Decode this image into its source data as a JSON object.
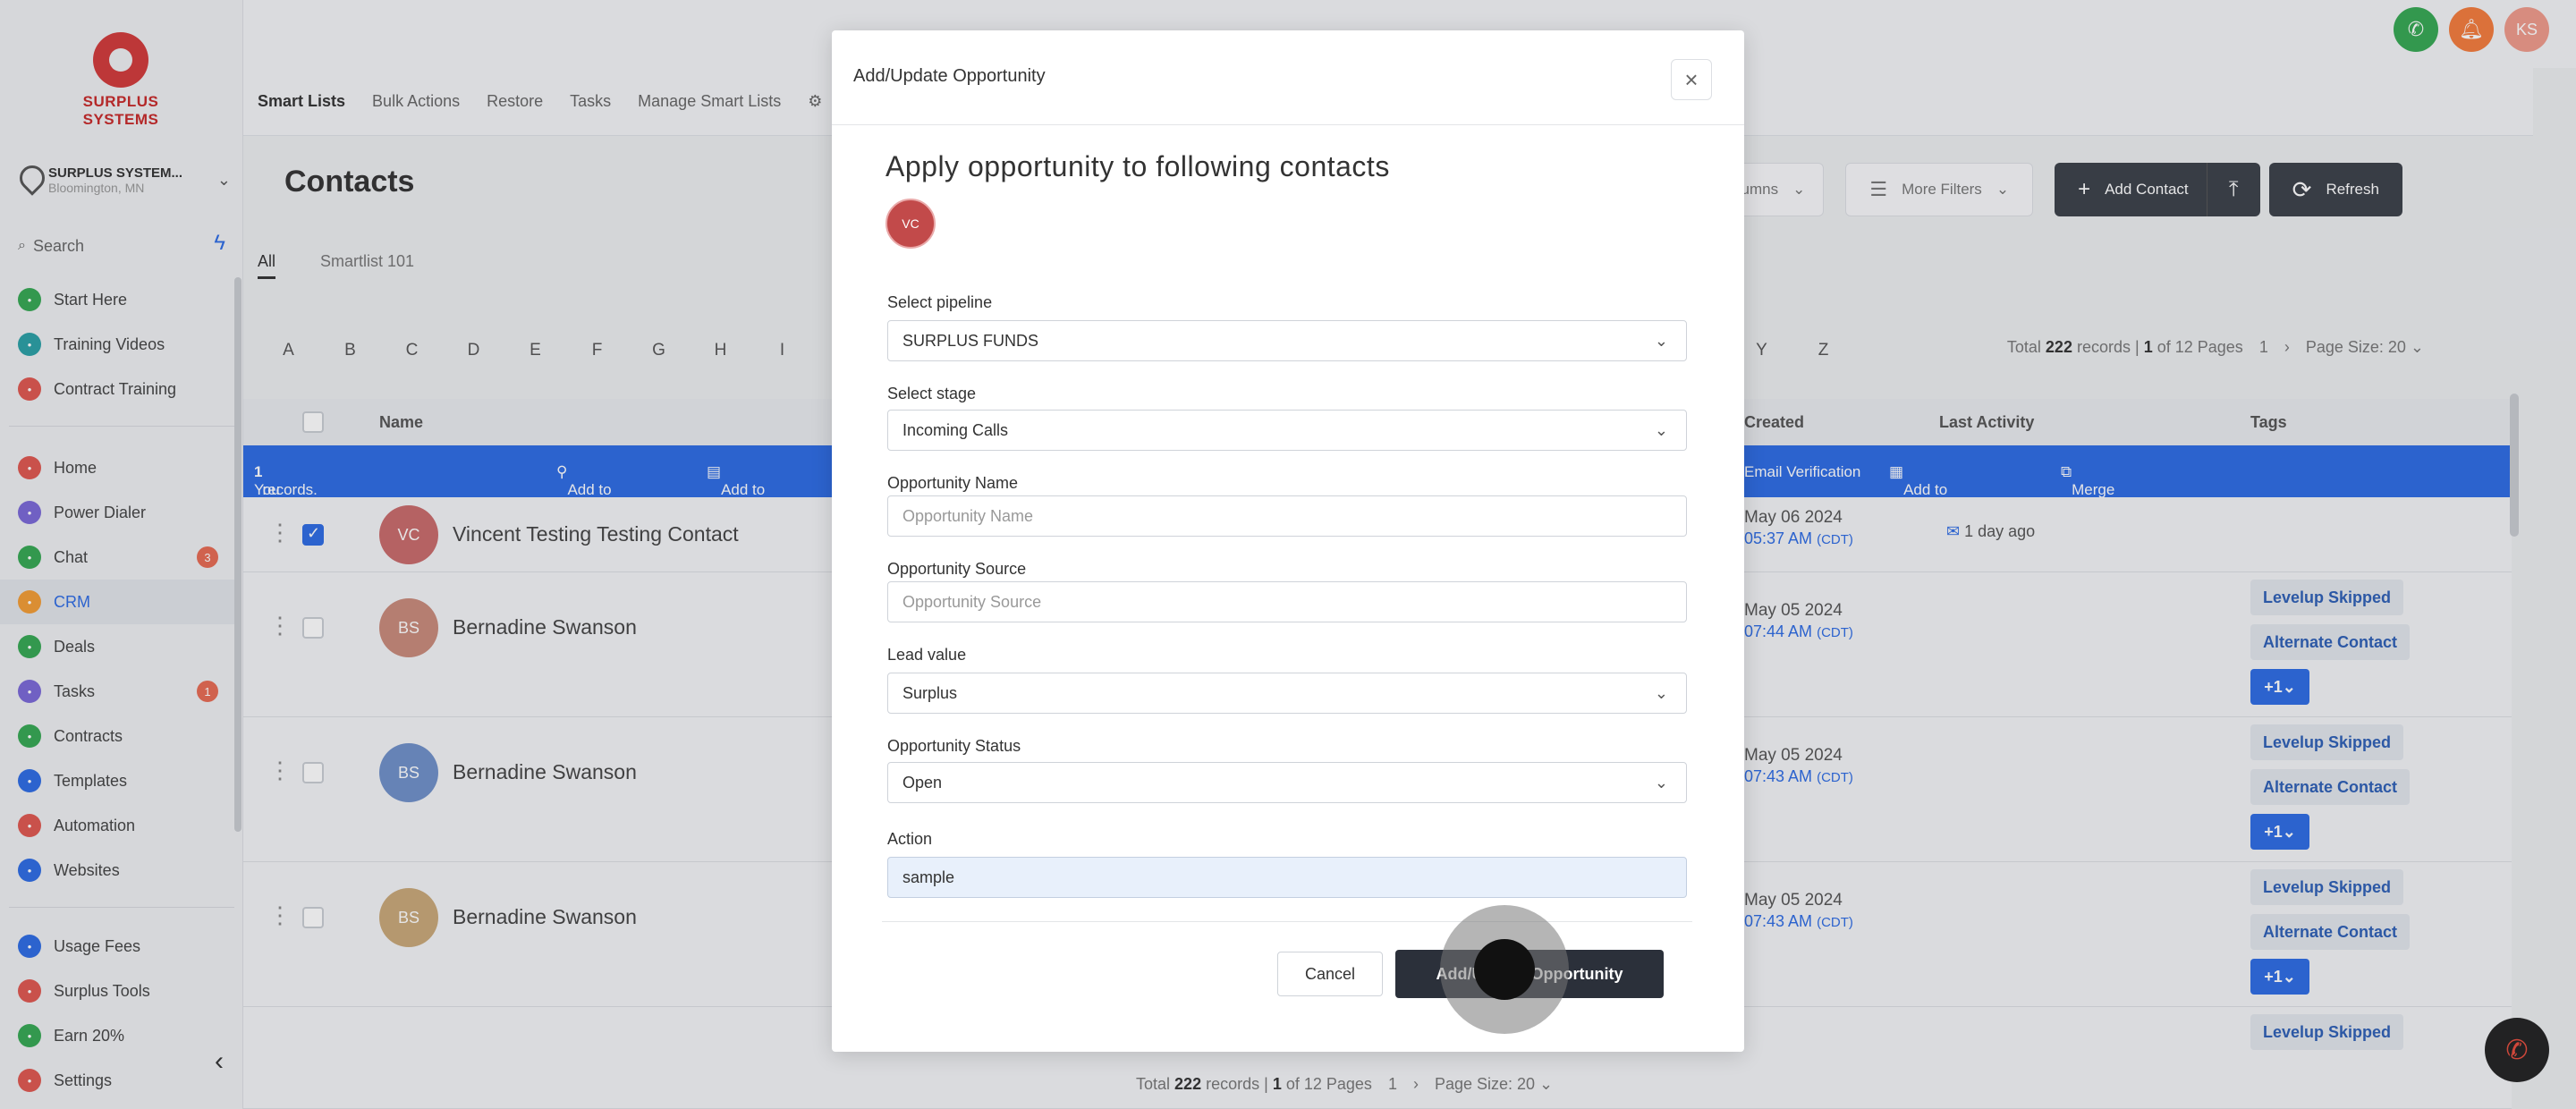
{
  "topbar": {
    "avatar_initials": "KS"
  },
  "sidebar": {
    "logo_text": "SURPLUS SYSTEMS",
    "account_name": "SURPLUS SYSTEM...",
    "account_location": "Bloomington, MN",
    "search_placeholder": "Search",
    "group1": [
      {
        "label": "Start Here",
        "color": "#35a852"
      },
      {
        "label": "Training Videos",
        "color": "#2aa0a6"
      },
      {
        "label": "Contract Training",
        "color": "#e0574f"
      }
    ],
    "group2": [
      {
        "label": "Home",
        "color": "#e0574f"
      },
      {
        "label": "Power Dialer",
        "color": "#7a68d8"
      },
      {
        "label": "Chat",
        "color": "#35a852",
        "badge": "3"
      },
      {
        "label": "CRM",
        "color": "#f39c34"
      },
      {
        "label": "Deals",
        "color": "#35a852"
      },
      {
        "label": "Tasks",
        "color": "#7a68d8",
        "badge": "1"
      },
      {
        "label": "Contracts",
        "color": "#35a852"
      },
      {
        "label": "Templates",
        "color": "#2d6be4"
      },
      {
        "label": "Automation",
        "color": "#e0574f"
      },
      {
        "label": "Websites",
        "color": "#2d6be4"
      }
    ],
    "group3": [
      {
        "label": "Usage Fees",
        "color": "#2d6be4"
      },
      {
        "label": "Surplus Tools",
        "color": "#e0574f"
      },
      {
        "label": "Earn 20%",
        "color": "#35a852"
      },
      {
        "label": "Settings",
        "color": "#e0574f"
      }
    ]
  },
  "subnav": [
    "Smart Lists",
    "Bulk Actions",
    "Restore",
    "Tasks",
    "Manage Smart Lists"
  ],
  "contacts": {
    "title": "Contacts",
    "tabs": [
      "All",
      "Smartlist 101"
    ],
    "toolbar": {
      "columns": "Columns",
      "more_filters": "More Filters",
      "add_contact": "Add Contact",
      "refresh": "Refresh"
    },
    "alpha_left": [
      "A",
      "B",
      "C",
      "D",
      "E",
      "F",
      "G",
      "H",
      "I"
    ],
    "alpha_right": [
      "Y",
      "Z"
    ],
    "pager": {
      "total_prefix": "Total",
      "total": "222",
      "records_text": "records |",
      "page": "1",
      "of_text": "of 12 Pages",
      "current": "1",
      "page_size": "Page Size: 20"
    },
    "columns": {
      "name": "Name",
      "created": "Created",
      "last_activity": "Last Activity",
      "tags": "Tags"
    },
    "selection_bar": {
      "text_prefix": "You have selected",
      "count": "1",
      "text_suffix": "records.",
      "add_to_pipeline": "Add to Pipeline",
      "add_to_workflow": "Add to Workflo",
      "email_verification": "Email Verification",
      "add_to_company": "Add to Company",
      "merge": "Merge"
    },
    "rows": [
      {
        "initials": "VC",
        "name": "Vincent Testing Testing Contact",
        "date": "May 06 2024",
        "time": "05:37 AM",
        "tz": "(CDT)",
        "activity": "1 day ago",
        "tags": [],
        "avatar_color": "#c96a6a"
      },
      {
        "initials": "BS",
        "name": "Bernadine Swanson",
        "date": "May 05 2024",
        "time": "07:44 AM",
        "tz": "(CDT)",
        "activity": "",
        "tags": [
          "Levelup Skipped",
          "Alternate Contact",
          "+1"
        ],
        "avatar_color": "#c98a7a"
      },
      {
        "initials": "BS",
        "name": "Bernadine Swanson",
        "date": "May 05 2024",
        "time": "07:43 AM",
        "tz": "(CDT)",
        "activity": "",
        "tags": [
          "Levelup Skipped",
          "Alternate Contact",
          "+1"
        ],
        "avatar_color": "#6f90c9"
      },
      {
        "initials": "BS",
        "name": "Bernadine Swanson",
        "date": "May 05 2024",
        "time": "07:43 AM",
        "tz": "(CDT)",
        "activity": "",
        "tags": [
          "Levelup Skipped",
          "Alternate Contact",
          "+1"
        ],
        "avatar_color": "#c9a878"
      },
      {
        "tags": [
          "Levelup Skipped"
        ]
      }
    ]
  },
  "modal": {
    "title": "Add/Update Opportunity",
    "heading": "Apply opportunity to following contacts",
    "avatar_initials": "VC",
    "pipeline_label": "Select pipeline",
    "pipeline_value": "SURPLUS FUNDS",
    "stage_label": "Select stage",
    "stage_value": "Incoming Calls",
    "name_label": "Opportunity Name",
    "name_placeholder": "Opportunity Name",
    "source_label": "Opportunity Source",
    "source_placeholder": "Opportunity Source",
    "lead_label": "Lead value",
    "lead_value": "Surplus",
    "status_label": "Opportunity Status",
    "status_value": "Open",
    "action_label": "Action",
    "action_value": "sample",
    "cancel": "Cancel",
    "submit": "Add/Update Opportunity"
  }
}
